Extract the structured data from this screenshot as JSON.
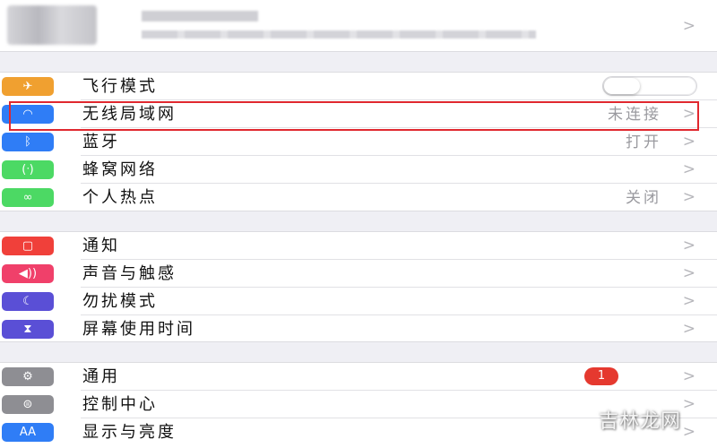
{
  "settings": {
    "group1": [
      {
        "key": "airplane",
        "icon": "airplane-icon",
        "icon_color": "#f0a030",
        "glyph": "✈",
        "label": "飞行模式",
        "control": "toggle",
        "toggle_on": false
      },
      {
        "key": "wifi",
        "icon": "wifi-icon",
        "icon_color": "#2f7df6",
        "glyph": "◠",
        "label": "无线局域网",
        "value": "未连接",
        "chevron": ">"
      },
      {
        "key": "bluetooth",
        "icon": "bluetooth-icon",
        "icon_color": "#2f7df6",
        "glyph": "ᛒ",
        "label": "蓝牙",
        "value": "打开",
        "chevron": ">"
      },
      {
        "key": "cellular",
        "icon": "cellular-icon",
        "icon_color": "#4cd964",
        "glyph": "(ᐧ)",
        "label": "蜂窝网络",
        "chevron": ">"
      },
      {
        "key": "hotspot",
        "icon": "hotspot-icon",
        "icon_color": "#4cd964",
        "glyph": "∞",
        "label": "个人热点",
        "value": "关闭",
        "chevron": ">"
      }
    ],
    "group2": [
      {
        "key": "notifications",
        "icon": "notifications-icon",
        "icon_color": "#f0403a",
        "glyph": "▢",
        "label": "通知",
        "chevron": ">"
      },
      {
        "key": "sounds",
        "icon": "sound-icon",
        "icon_color": "#f0406a",
        "glyph": "◀))",
        "label": "声音与触感",
        "chevron": ">"
      },
      {
        "key": "dnd",
        "icon": "moon-icon",
        "icon_color": "#5a4fd6",
        "glyph": "☾",
        "label": "勿扰模式",
        "chevron": ">"
      },
      {
        "key": "screentime",
        "icon": "hourglass-icon",
        "icon_color": "#5a4fd6",
        "glyph": "⧗",
        "label": "屏幕使用时间",
        "chevron": ">"
      }
    ],
    "group3": [
      {
        "key": "general",
        "icon": "gear-icon",
        "icon_color": "#8e8e93",
        "glyph": "⚙",
        "label": "通用",
        "badge": "1",
        "chevron": ">"
      },
      {
        "key": "control_center",
        "icon": "toggles-icon",
        "icon_color": "#8e8e93",
        "glyph": "⊜",
        "label": "控制中心",
        "chevron": ">"
      },
      {
        "key": "display",
        "icon": "display-icon",
        "icon_color": "#2f7df6",
        "glyph": "AA",
        "label": "显示与亮度",
        "chevron": ">"
      }
    ]
  },
  "profile": {
    "chevron": ">"
  },
  "highlight_color": "#e0282f",
  "watermark": "吉林龙网"
}
